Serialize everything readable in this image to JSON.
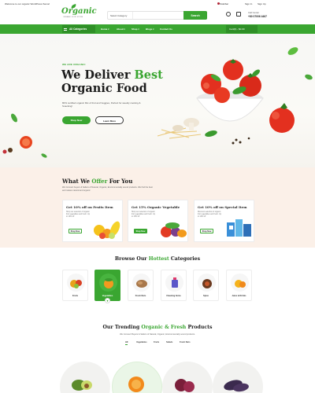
{
  "topbar": {
    "welcome": "Welcome to our organic WordPress theme!",
    "language": "Stdolbar",
    "signin": "Sign In",
    "signup": "Sign Up"
  },
  "header": {
    "logo": "Organic",
    "logo_sub": "ORGANIC FOOD STORE",
    "search_category": "Select Category",
    "search_placeholder": "",
    "search_button": "Search",
    "call_label": "Call Center",
    "call_number": "+80 07006 4467"
  },
  "nav": {
    "all_categories": "All Categories",
    "items": [
      "Home",
      "About",
      "Shop",
      "Blogs",
      "Contact Us"
    ],
    "right": "Cart(0) - $0.00"
  },
  "hero": {
    "tag": "WE ARE ORGANIC",
    "title_line1_a": "We Deliver ",
    "title_line1_b": "Best",
    "title_line2": "Organic Food",
    "description": "80% certified organic Mix of fruit and Veggies, Perfect for weekly cooking & Snacking!",
    "btn_shop": "Shop Now",
    "btn_more": "Learn More"
  },
  "offer": {
    "title_a": "What We ",
    "title_b": "Offer",
    "title_c": " For You",
    "subtitle": "We Connect buyers & Sellers of Natural, Organic, Environmentally sound products. We find the best and makes natural and organic",
    "cards": [
      {
        "title": "Get 10% off on Fruits Item",
        "desc": "Shop our selection of organic fruit vegetables and fresh. Up to 10% off",
        "button": "Shop Now"
      },
      {
        "title": "Get 15% Organic Vegetable",
        "desc": "Shop our selection of organic fruit vegetables and fresh. Up to 15% off",
        "button": "Shop Now"
      },
      {
        "title": "Get 10% off on Special Item",
        "desc": "Discount selection of organic fruit vegetables and fresh. Up to 10% off",
        "button": "Shop Now"
      }
    ]
  },
  "categories": {
    "title_a": "Browse Our ",
    "title_b": "Hottest",
    "title_c": " Categories",
    "items": [
      "Fruits",
      "Vegetables",
      "Fresh Nuts",
      "Cleaning Items",
      "Spice",
      "Juice & Drinks"
    ]
  },
  "trending": {
    "title_a": "Our Trending ",
    "title_b": "Organic & Fresh",
    "title_c": " Products",
    "subtitle": "We Connect Buyers & Sellers of Natural, Organic, Environmentally sound products.",
    "tabs": [
      "All",
      "Vegetables",
      "Fruits",
      "Salads",
      "Fresh Nuts"
    ]
  },
  "colors": {
    "accent": "#3aa631",
    "offer_bg": "#fbf0e8"
  }
}
